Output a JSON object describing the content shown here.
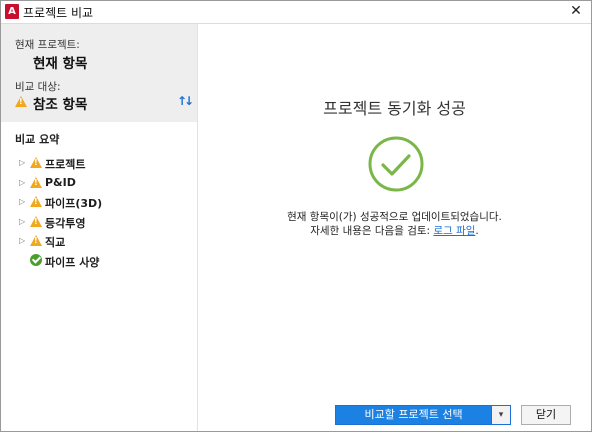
{
  "window": {
    "app_icon_letter": "A",
    "title": "프로젝트 비교",
    "close_glyph": "✕"
  },
  "left": {
    "current_label": "현재 프로젝트:",
    "current_value": "현재 항목",
    "compare_label": "비교 대상:",
    "compare_value": "참조 항목",
    "compare_icon": "warning-icon",
    "swap_icon": "swap-arrows-icon",
    "summary_title": "비교 요약",
    "tree": [
      {
        "label": "프로젝트",
        "status": "warning",
        "expandable": true
      },
      {
        "label": "P&ID",
        "status": "warning",
        "expandable": true
      },
      {
        "label": "파이프(3D)",
        "status": "warning",
        "expandable": true
      },
      {
        "label": "등각투영",
        "status": "warning",
        "expandable": true
      },
      {
        "label": "직교",
        "status": "warning",
        "expandable": true
      },
      {
        "label": "파이프 사양",
        "status": "ok",
        "expandable": false
      }
    ]
  },
  "main": {
    "title": "프로젝트 동기화 성공",
    "status_icon": "success-check-icon",
    "message_line1": "현재 항목이(가) 성공적으로 업데이트되었습니다.",
    "message_line2_prefix": "자세한 내용은 다음을 검토: ",
    "log_link": "로그 파일",
    "message_line2_suffix": "."
  },
  "footer": {
    "select_project_button": "비교할 프로젝트 선택",
    "dropdown_glyph": "▾",
    "close_button": "닫기"
  },
  "colors": {
    "accent": "#1b82e4",
    "success": "#7ab648",
    "warning": "#f0a81e",
    "left_header_bg": "#eeeeee"
  }
}
